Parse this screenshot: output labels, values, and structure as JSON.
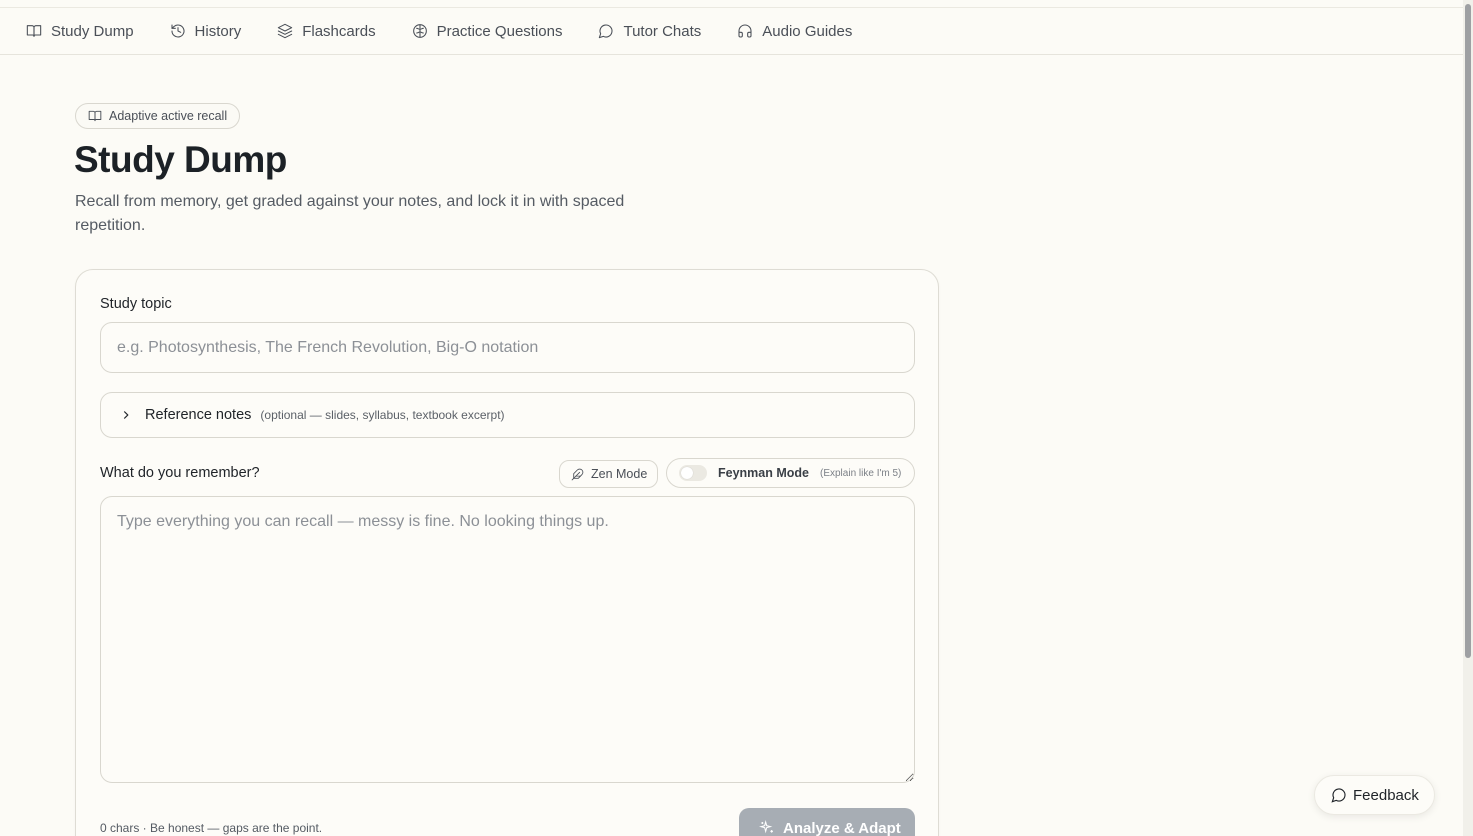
{
  "nav": {
    "items": [
      {
        "label": "Study Dump",
        "icon": "book-icon"
      },
      {
        "label": "History",
        "icon": "history-icon"
      },
      {
        "label": "Flashcards",
        "icon": "layers-icon"
      },
      {
        "label": "Practice Questions",
        "icon": "brain-icon"
      },
      {
        "label": "Tutor Chats",
        "icon": "chat-bubble-icon"
      },
      {
        "label": "Audio Guides",
        "icon": "headphones-icon"
      }
    ]
  },
  "header": {
    "badge": "Adaptive active recall",
    "title": "Study Dump",
    "subtitle": "Recall from memory, get graded against your notes, and lock it in with spaced repetition."
  },
  "form": {
    "topic_label": "Study topic",
    "topic_placeholder": "e.g. Photosynthesis, The French Revolution, Big-O notation",
    "topic_value": "",
    "reference_title": "Reference notes",
    "reference_hint": "(optional — slides, syllabus, textbook excerpt)",
    "recall_label": "What do you remember?",
    "zen_label": "Zen Mode",
    "feynman_label": "Feynman Mode",
    "feynman_hint": "(Explain like I'm 5)",
    "feynman_enabled": false,
    "recall_placeholder": "Type everything you can recall — messy is fine. No looking things up.",
    "recall_value": "",
    "counter": "0 chars · Be honest — gaps are the point.",
    "analyze_label": "Analyze & Adapt"
  },
  "feedback_label": "Feedback",
  "colors": {
    "background": "#fcfbf6",
    "button_disabled": "#a7adb4",
    "text_primary": "#1c2126"
  }
}
